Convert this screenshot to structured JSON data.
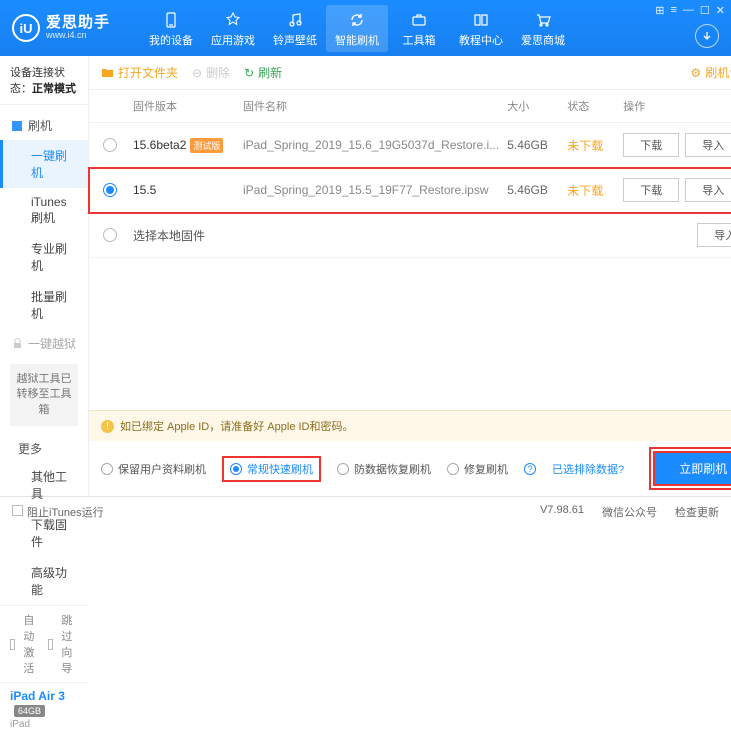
{
  "brand": {
    "cn": "爱思助手",
    "url": "www.i4.cn",
    "logo_text": "iU"
  },
  "window_icons": [
    "⊞",
    "≡",
    "—",
    "☐",
    "✕"
  ],
  "nav": [
    {
      "label": "我的设备"
    },
    {
      "label": "应用游戏"
    },
    {
      "label": "铃声壁纸"
    },
    {
      "label": "智能刷机",
      "active": true
    },
    {
      "label": "工具箱"
    },
    {
      "label": "教程中心"
    },
    {
      "label": "爱思商城"
    }
  ],
  "status": {
    "prefix": "设备连接状态：",
    "value": "正常模式"
  },
  "sidebar": {
    "flash_head": "刷机",
    "flash_items": [
      {
        "label": "一键刷机",
        "active": true
      },
      {
        "label": "iTunes刷机"
      },
      {
        "label": "专业刷机"
      },
      {
        "label": "批量刷机"
      }
    ],
    "jailbreak_head": "一键越狱",
    "jailbreak_note": "越狱工具已转移至工具箱",
    "more_head": "更多",
    "more_items": [
      {
        "label": "其他工具"
      },
      {
        "label": "下载固件"
      },
      {
        "label": "高级功能"
      }
    ],
    "opts": {
      "auto_activate": "自动激活",
      "skip_guide": "跳过向导"
    },
    "device": {
      "name": "iPad Air 3",
      "storage": "64GB",
      "type": "iPad"
    }
  },
  "toolbar": {
    "open": "打开文件夹",
    "delete": "删除",
    "refresh": "刷新",
    "settings": "刷机设置"
  },
  "columns": {
    "version": "固件版本",
    "name": "固件名称",
    "size": "大小",
    "status": "状态",
    "ops": "操作"
  },
  "rows": [
    {
      "version": "15.6beta2",
      "tag": "测试版",
      "name": "iPad_Spring_2019_15.6_19G5037d_Restore.i...",
      "size": "5.46GB",
      "status": "未下载",
      "selected": false
    },
    {
      "version": "15.5",
      "tag": "",
      "name": "iPad_Spring_2019_15.5_19F77_Restore.ipsw",
      "size": "5.46GB",
      "status": "未下载",
      "selected": true
    }
  ],
  "local_row": "选择本地固件",
  "btn_download": "下载",
  "btn_import": "导入",
  "banner": "如已绑定 Apple ID，请准备好 Apple ID和密码。",
  "modes": {
    "keep": "保留用户资料刷机",
    "normal": "常规快速刷机",
    "antirec": "防数据恢复刷机",
    "repair": "修复刷机",
    "exclude": "已选排除数据?",
    "flash": "立即刷机"
  },
  "footer": {
    "block_itunes": "阻止iTunes运行",
    "version": "V7.98.61",
    "wechat": "微信公众号",
    "update": "检查更新"
  }
}
